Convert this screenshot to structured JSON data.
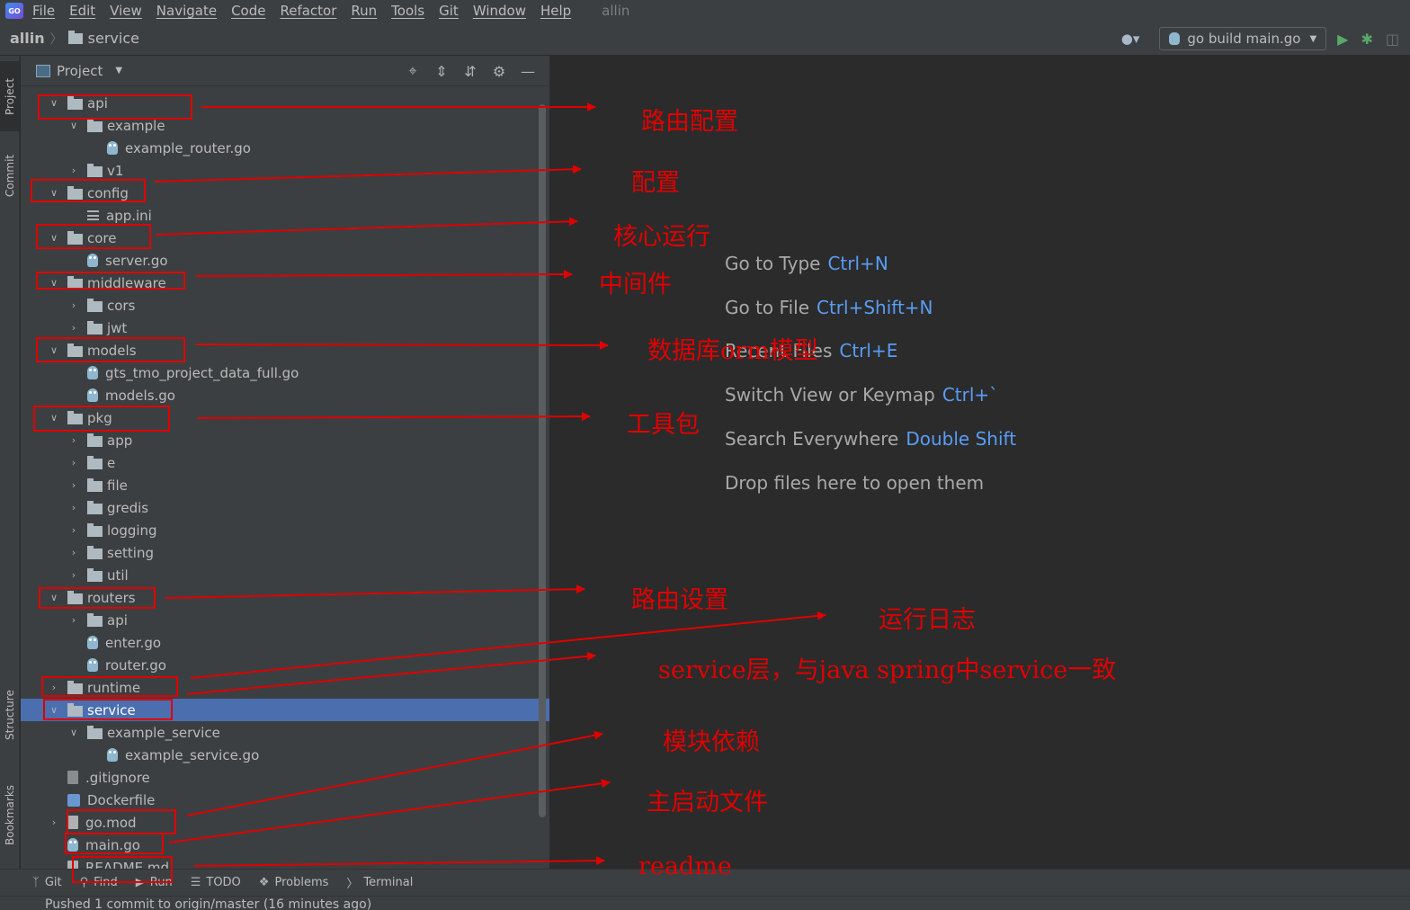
{
  "menubar": {
    "items": [
      "File",
      "Edit",
      "View",
      "Navigate",
      "Code",
      "Refactor",
      "Run",
      "Tools",
      "Git",
      "Window",
      "Help"
    ],
    "project_name": "allin"
  },
  "navbar": {
    "root": "allin",
    "current": "service",
    "run_config": "go build main.go"
  },
  "left_stripe": {
    "tabs": [
      "Project",
      "Commit",
      "Structure",
      "Bookmarks"
    ]
  },
  "panel": {
    "title": "Project"
  },
  "tree": [
    {
      "label": "api",
      "depth": 0,
      "type": "folder",
      "arrow": "down"
    },
    {
      "label": "example",
      "depth": 1,
      "type": "folder",
      "arrow": "down"
    },
    {
      "label": "example_router.go",
      "depth": 2,
      "type": "go",
      "arrow": "none"
    },
    {
      "label": "v1",
      "depth": 1,
      "type": "folder",
      "arrow": "right"
    },
    {
      "label": "config",
      "depth": 0,
      "type": "folder",
      "arrow": "down"
    },
    {
      "label": "app.ini",
      "depth": 1,
      "type": "ini",
      "arrow": "none"
    },
    {
      "label": "core",
      "depth": 0,
      "type": "folder",
      "arrow": "down"
    },
    {
      "label": "server.go",
      "depth": 1,
      "type": "go",
      "arrow": "none"
    },
    {
      "label": "middleware",
      "depth": 0,
      "type": "folder",
      "arrow": "down"
    },
    {
      "label": "cors",
      "depth": 1,
      "type": "folder",
      "arrow": "right"
    },
    {
      "label": "jwt",
      "depth": 1,
      "type": "folder",
      "arrow": "right"
    },
    {
      "label": "models",
      "depth": 0,
      "type": "folder",
      "arrow": "down"
    },
    {
      "label": "gts_tmo_project_data_full.go",
      "depth": 1,
      "type": "go",
      "arrow": "none"
    },
    {
      "label": "models.go",
      "depth": 1,
      "type": "go",
      "arrow": "none"
    },
    {
      "label": "pkg",
      "depth": 0,
      "type": "folder",
      "arrow": "down"
    },
    {
      "label": "app",
      "depth": 1,
      "type": "folder",
      "arrow": "right"
    },
    {
      "label": "e",
      "depth": 1,
      "type": "folder",
      "arrow": "right"
    },
    {
      "label": "file",
      "depth": 1,
      "type": "folder",
      "arrow": "right"
    },
    {
      "label": "gredis",
      "depth": 1,
      "type": "folder",
      "arrow": "right"
    },
    {
      "label": "logging",
      "depth": 1,
      "type": "folder",
      "arrow": "right"
    },
    {
      "label": "setting",
      "depth": 1,
      "type": "folder",
      "arrow": "right"
    },
    {
      "label": "util",
      "depth": 1,
      "type": "folder",
      "arrow": "right"
    },
    {
      "label": "routers",
      "depth": 0,
      "type": "folder",
      "arrow": "down"
    },
    {
      "label": "api",
      "depth": 1,
      "type": "folder",
      "arrow": "right"
    },
    {
      "label": "enter.go",
      "depth": 1,
      "type": "go",
      "arrow": "none"
    },
    {
      "label": "router.go",
      "depth": 1,
      "type": "go",
      "arrow": "none"
    },
    {
      "label": "runtime",
      "depth": 0,
      "type": "folder",
      "arrow": "right"
    },
    {
      "label": "service",
      "depth": 0,
      "type": "folder",
      "arrow": "down",
      "selected": true
    },
    {
      "label": "example_service",
      "depth": 1,
      "type": "folder",
      "arrow": "down"
    },
    {
      "label": "example_service.go",
      "depth": 2,
      "type": "go",
      "arrow": "none"
    },
    {
      "label": ".gitignore",
      "depth": 0,
      "type": "gitignore",
      "arrow": "none"
    },
    {
      "label": "Dockerfile",
      "depth": 0,
      "type": "docker",
      "arrow": "none"
    },
    {
      "label": "go.mod",
      "depth": 0,
      "type": "text",
      "arrow": "right"
    },
    {
      "label": "main.go",
      "depth": 0,
      "type": "go",
      "arrow": "none"
    },
    {
      "label": "README.md",
      "depth": 0,
      "type": "text",
      "arrow": "none"
    }
  ],
  "editor_hints": [
    {
      "text": "Go to Type",
      "key": "Ctrl+N"
    },
    {
      "text": "Go to File",
      "key": "Ctrl+Shift+N"
    },
    {
      "text": "Recent Files",
      "key": "Ctrl+E"
    },
    {
      "text": "Switch View or Keymap",
      "key": "Ctrl+`"
    },
    {
      "text": "Search Everywhere",
      "key": "Double Shift"
    },
    {
      "text": "Drop files here to open them",
      "key": ""
    }
  ],
  "bottom_tabs": [
    "Git",
    "Find",
    "Run",
    "TODO",
    "Problems",
    "Terminal"
  ],
  "status": "Pushed 1 commit to origin/master (16 minutes ago)",
  "annotations": [
    "路由配置",
    "配置",
    "核心运行",
    "中间件",
    "数据库orm模型",
    "工具包",
    "路由设置",
    "运行日志",
    "service层，与java spring中service一致",
    "模块依赖",
    "主启动文件",
    "readme"
  ],
  "colors": {
    "annotation": "#e00000",
    "selection": "#4b6eaf",
    "shortcut": "#589df6"
  }
}
